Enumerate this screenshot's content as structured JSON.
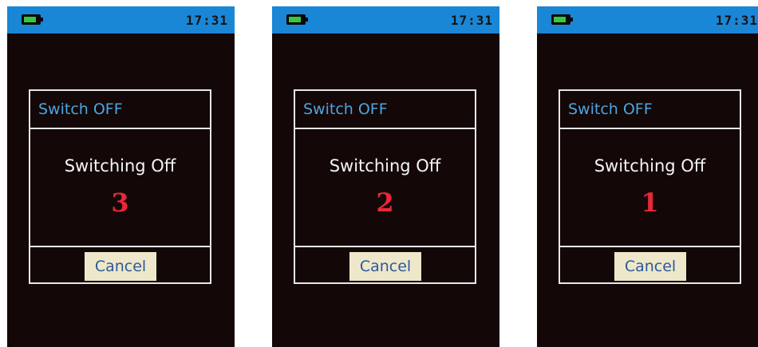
{
  "screens": [
    {
      "status": {
        "time": "17:31",
        "battery_icon": "battery-icon"
      },
      "dialog": {
        "title": "Switch OFF",
        "message": "Switching Off",
        "countdown": "3",
        "cancel_label": "Cancel"
      }
    },
    {
      "status": {
        "time": "17:31",
        "battery_icon": "battery-icon"
      },
      "dialog": {
        "title": "Switch OFF",
        "message": "Switching Off",
        "countdown": "2",
        "cancel_label": "Cancel"
      }
    },
    {
      "status": {
        "time": "17:31",
        "battery_icon": "battery-icon"
      },
      "dialog": {
        "title": "Switch OFF",
        "message": "Switching Off",
        "countdown": "1",
        "cancel_label": "Cancel"
      }
    }
  ],
  "colors": {
    "status_bar": "#1a86d6",
    "screen_bg": "#140707",
    "title_text": "#49a6e2",
    "countdown_text": "#e8283a",
    "button_bg": "#efe7c9",
    "button_text": "#2b5a9c",
    "battery_fill": "#37c93a"
  }
}
